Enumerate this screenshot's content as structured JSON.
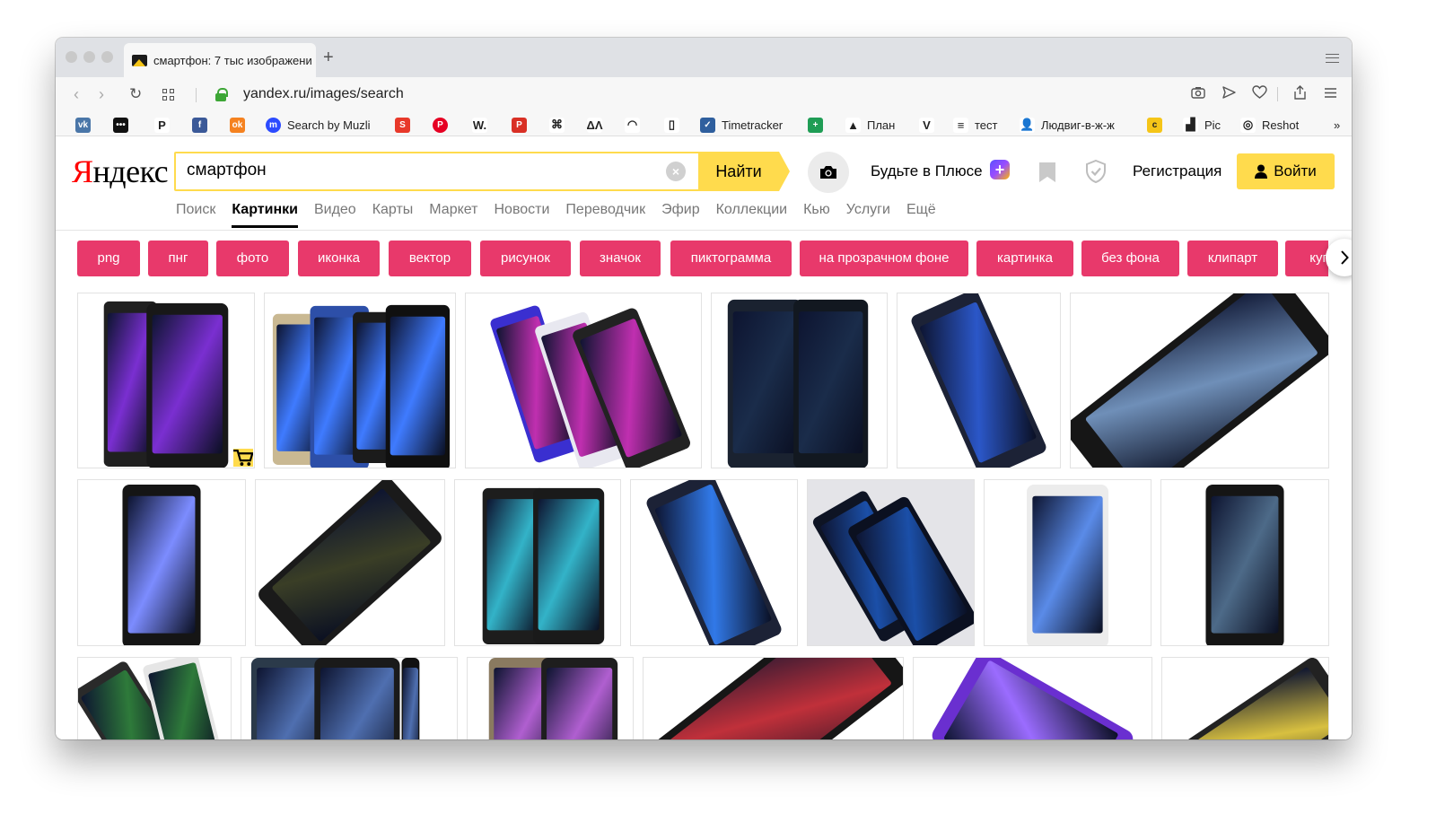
{
  "browser": {
    "tab_title": "смартфон: 7 тыс изображени",
    "url": "yandex.ru/images/search",
    "bookmarks": [
      {
        "icon": "vk-icon",
        "label": "",
        "color": "#4a76a8",
        "glyph": "vk"
      },
      {
        "icon": "dots-icon",
        "label": "",
        "color": "#111111",
        "glyph": "•••"
      },
      {
        "icon": "paypal-icon",
        "label": "",
        "color": "#ffffff",
        "glyph": "P"
      },
      {
        "icon": "facebook-icon",
        "label": "",
        "color": "#3b5998",
        "glyph": "f"
      },
      {
        "icon": "odnoklassniki-icon",
        "label": "",
        "color": "#f58220",
        "glyph": "ok"
      },
      {
        "icon": "muzli-icon",
        "label": "Search by Muzli",
        "color": "#2c4bff",
        "glyph": "m"
      },
      {
        "icon": "red-square-icon",
        "label": "",
        "color": "#e8392a",
        "glyph": "S"
      },
      {
        "icon": "pinterest-icon",
        "label": "",
        "color": "#e60023",
        "glyph": "P"
      },
      {
        "icon": "w-icon",
        "label": "",
        "color": "#ffffff",
        "glyph": "W."
      },
      {
        "icon": "p-red-icon",
        "label": "",
        "color": "#d93025",
        "glyph": "P"
      },
      {
        "icon": "command-icon",
        "label": "",
        "color": "#ffffff",
        "glyph": "⌘"
      },
      {
        "icon": "delta-lambda-icon",
        "label": "",
        "color": "#ffffff",
        "glyph": "ΔΛ"
      },
      {
        "icon": "gauge-icon",
        "label": "",
        "color": "#ffffff",
        "glyph": "◠"
      },
      {
        "icon": "file-icon",
        "label": "",
        "color": "#ffffff",
        "glyph": "▯"
      },
      {
        "icon": "timetracker-icon",
        "label": "Timetracker",
        "color": "#2f5f9e",
        "glyph": "✓"
      },
      {
        "icon": "plus-green-icon",
        "label": "",
        "color": "#1f9d55",
        "glyph": "+"
      },
      {
        "icon": "drive-icon",
        "label": "План",
        "color": "#ffffff",
        "glyph": "▲"
      },
      {
        "icon": "v-icon",
        "label": "",
        "color": "#ffffff",
        "glyph": "V"
      },
      {
        "icon": "test-icon",
        "label": "тест",
        "color": "#ffffff",
        "glyph": "≡"
      },
      {
        "icon": "person-icon",
        "label": "Людвиг-в-ж-ж",
        "color": "#ffffff",
        "glyph": "👤"
      },
      {
        "icon": "c-yellow-icon",
        "label": "",
        "color": "#f5c518",
        "glyph": "c"
      },
      {
        "icon": "pic-icon",
        "label": "Pic",
        "color": "#ffffff",
        "glyph": "▟"
      },
      {
        "icon": "reshot-icon",
        "label": "Reshot",
        "color": "#ffffff",
        "glyph": "◎"
      }
    ],
    "more": "»"
  },
  "yandex": {
    "logo": "Яндекс",
    "logo_first": "Я",
    "logo_rest": "ндекс",
    "query": "смартфон",
    "search_button": "Найти",
    "plus_text": "Будьте в Плюсе",
    "register": "Регистрация",
    "login": "Войти",
    "services": [
      {
        "label": "Поиск",
        "active": false
      },
      {
        "label": "Картинки",
        "active": true
      },
      {
        "label": "Видео",
        "active": false
      },
      {
        "label": "Карты",
        "active": false
      },
      {
        "label": "Маркет",
        "active": false
      },
      {
        "label": "Новости",
        "active": false
      },
      {
        "label": "Переводчик",
        "active": false
      },
      {
        "label": "Эфир",
        "active": false
      },
      {
        "label": "Коллекции",
        "active": false
      },
      {
        "label": "Кью",
        "active": false
      },
      {
        "label": "Услуги",
        "active": false
      },
      {
        "label": "Ещё",
        "active": false
      }
    ],
    "chips": [
      "png",
      "пнг",
      "фото",
      "иконка",
      "вектор",
      "рисунок",
      "значок",
      "пиктограмма",
      "на прозрачном фоне",
      "картинка",
      "без фона",
      "клипарт",
      "купить"
    ],
    "accent_color": "#ffdb4d",
    "chip_color": "#e8396b"
  }
}
